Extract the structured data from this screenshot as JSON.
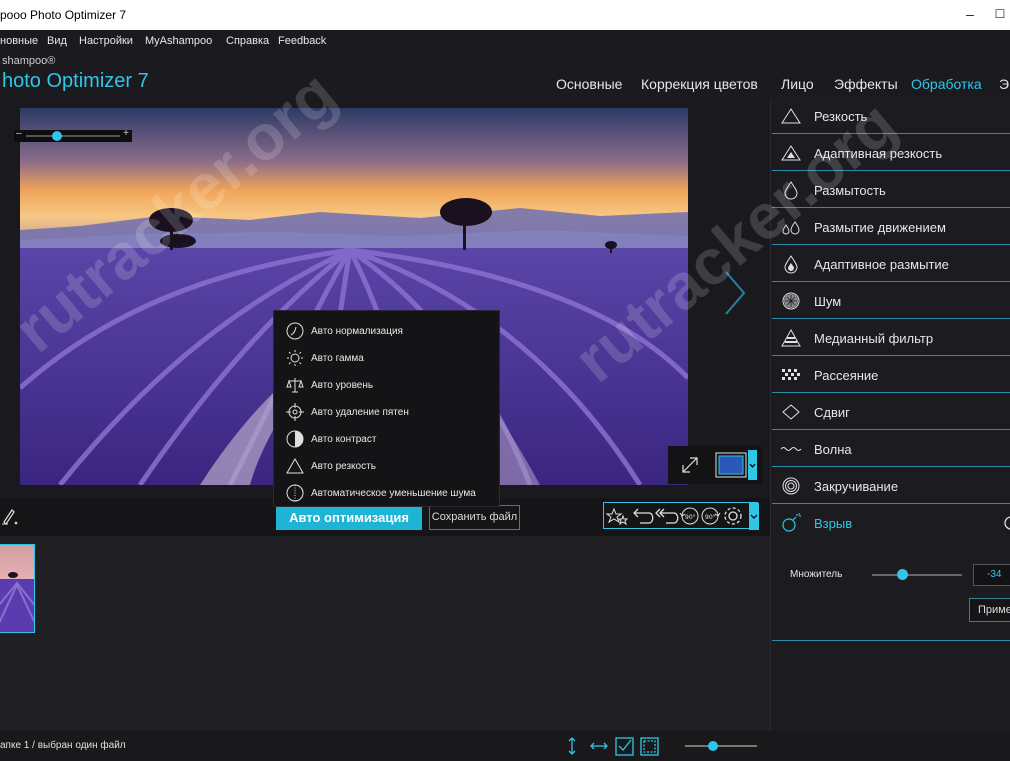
{
  "window": {
    "title": "pooo Photo Optimizer 7",
    "minimize": "–",
    "maximize": "☐"
  },
  "menu": [
    "новные",
    "Вид",
    "Настройки",
    "MyAshampoo",
    "Справка",
    "Feedback"
  ],
  "brand": {
    "small": "shampoo®",
    "big": "hoto Optimizer 7"
  },
  "tabs": [
    {
      "label": "Основные",
      "active": false
    },
    {
      "label": "Коррекция цветов",
      "active": false
    },
    {
      "label": "Лицо",
      "active": false
    },
    {
      "label": "Эффекты",
      "active": false
    },
    {
      "label": "Обработка",
      "active": true
    },
    {
      "label": "Э",
      "active": false
    }
  ],
  "zoom": {
    "minus": "–",
    "plus": "+"
  },
  "auto_menu": [
    {
      "label": "Авто нормализация",
      "icon": "normalize-icon"
    },
    {
      "label": "Авто гамма",
      "icon": "sun-icon"
    },
    {
      "label": "Авто уровень",
      "icon": "scales-icon"
    },
    {
      "label": "Авто удаление пятен",
      "icon": "crosshair-icon"
    },
    {
      "label": "Авто контраст",
      "icon": "contrast-icon"
    },
    {
      "label": "Авто резкость",
      "icon": "triangle-icon"
    },
    {
      "label": "Автоматическое уменьшение шума",
      "icon": "noise-circle-icon"
    }
  ],
  "actions": {
    "auto_optimize": "Авто оптимизация",
    "save_file": "Сохранить файл"
  },
  "effects": [
    {
      "label": "Резкость",
      "icon": "triangle-outline-icon"
    },
    {
      "label": "Адаптивная резкость",
      "icon": "triangle-filled-icon"
    },
    {
      "label": "Размытость",
      "icon": "drop-outline-icon"
    },
    {
      "label": "Размытие движением",
      "icon": "motion-drops-icon"
    },
    {
      "label": "Адаптивное размытие",
      "icon": "drop-filled-icon"
    },
    {
      "label": "Шум",
      "icon": "noise-ball-icon"
    },
    {
      "label": "Медианный фильтр",
      "icon": "pyramid-icon"
    },
    {
      "label": "Рассеяние",
      "icon": "scatter-icon"
    },
    {
      "label": "Сдвиг",
      "icon": "diamond-icon"
    },
    {
      "label": "Волна",
      "icon": "wave-icon"
    },
    {
      "label": "Закручивание",
      "icon": "swirl-icon"
    },
    {
      "label": "Взрыв",
      "icon": "bomb-icon",
      "active": true
    }
  ],
  "explode": {
    "multiplier_label": "Множитель",
    "value": "-34",
    "apply": "Приме"
  },
  "status": {
    "text": "апке 1 / выбран один файл"
  },
  "watermark": "rutracker.org",
  "colors": {
    "accent": "#2ec7e8",
    "background": "#1f1f24"
  }
}
